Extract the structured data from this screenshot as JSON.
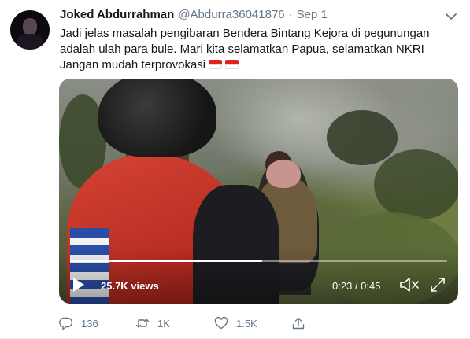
{
  "tweet": {
    "author": {
      "display_name": "Joked Abdurrahman",
      "handle": "@Abdurra36041876",
      "separator": "·",
      "time": "Sep 1"
    },
    "text_lines": [
      "Jadi jelas masalah pengibaran Bendera Bintang Kejora di pegunungan",
      "adalah ulah para bule. Mari kita selamatkan Papua, selamatkan NKRI",
      "Jangan mudah terprovokasi"
    ],
    "emoji": [
      "flag-indonesia",
      "flag-indonesia"
    ],
    "video": {
      "views": "25.7K views",
      "timecode": "0:23 / 0:45",
      "progress": 0.51
    },
    "actions": {
      "replies": "136",
      "retweets": "1K",
      "likes": "1.5K"
    }
  },
  "colors": {
    "text": "#14171a",
    "muted": "#657786",
    "flag_red": "#e2231a",
    "flag_white": "#ffffff"
  },
  "icons": [
    "chevron-down-icon",
    "play-icon",
    "volume-icon",
    "fullscreen-icon",
    "reply-icon",
    "retweet-icon",
    "like-icon",
    "share-icon"
  ]
}
